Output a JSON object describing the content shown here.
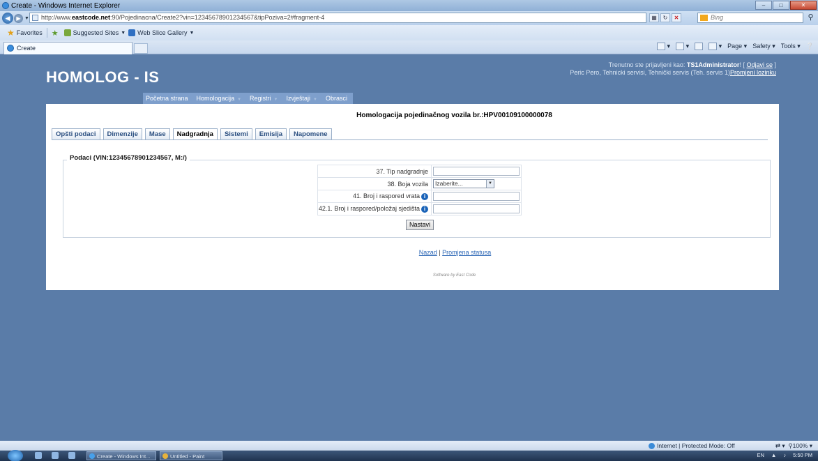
{
  "browser": {
    "window_title": "Create - Windows Internet Explorer",
    "url_prefix": "http://www.",
    "url_domain": "eastcode.net",
    "url_rest": ":90/Pojedinacna/Create2?vin=12345678901234567&tipPoziva=2#fragment-4",
    "search_placeholder": "Bing",
    "favorites_label": "Favorites",
    "fav_suggested": "Suggested Sites",
    "fav_webslice": "Web Slice Gallery",
    "tab_title": "Create",
    "cmd_page": "Page",
    "cmd_safety": "Safety",
    "cmd_tools": "Tools",
    "status_zone": "Internet | Protected Mode: Off",
    "zoom": "100%"
  },
  "header": {
    "app_title": "HOMOLOG - IS",
    "logged_in_prefix": "Trenutno ste prijavljeni kao:",
    "username": "TS1Administrator",
    "logout_label": "Odjavi se",
    "user_details": "Peric Pero, Tehnicki servisi, Tehnički servis (Teh. servis 1)",
    "change_password": "Promjeni lozinku"
  },
  "menu": {
    "items": [
      {
        "label": "Početna strana"
      },
      {
        "label": "Homologacija"
      },
      {
        "label": "Registri"
      },
      {
        "label": "Izvještaji"
      },
      {
        "label": "Obrasci"
      }
    ]
  },
  "form": {
    "title": "Homologacija pojedinačnog vozila br.:HPV00109100000078",
    "tabs": [
      {
        "label": "Opšti podaci"
      },
      {
        "label": "Dimenzije"
      },
      {
        "label": "Mase"
      },
      {
        "label": "Nadgradnja"
      },
      {
        "label": "Sistemi"
      },
      {
        "label": "Emisija"
      },
      {
        "label": "Napomene"
      }
    ],
    "active_tab": "Nadgradnja",
    "legend": "Podaci (VIN:12345678901234567, M:/)",
    "fields": [
      {
        "label": "37. Tip nadgradnje",
        "value": ""
      },
      {
        "label": "38. Boja vozila",
        "select_value": "Izaberite..."
      },
      {
        "label": "41. Broj i raspored vrata",
        "value": ""
      },
      {
        "label": "42.1. Broj i raspored/položaj sjedišta",
        "value": ""
      }
    ],
    "submit_label": "Nastavi"
  },
  "links": {
    "back": "Nazad",
    "separator": "|",
    "status_change": "Promjena statusa"
  },
  "footer": "Software by East Code",
  "taskbar": {
    "task1": "Create - Windows Int...",
    "task2": "Untitled - Paint",
    "lang": "EN",
    "clock": "5:50 PM"
  }
}
